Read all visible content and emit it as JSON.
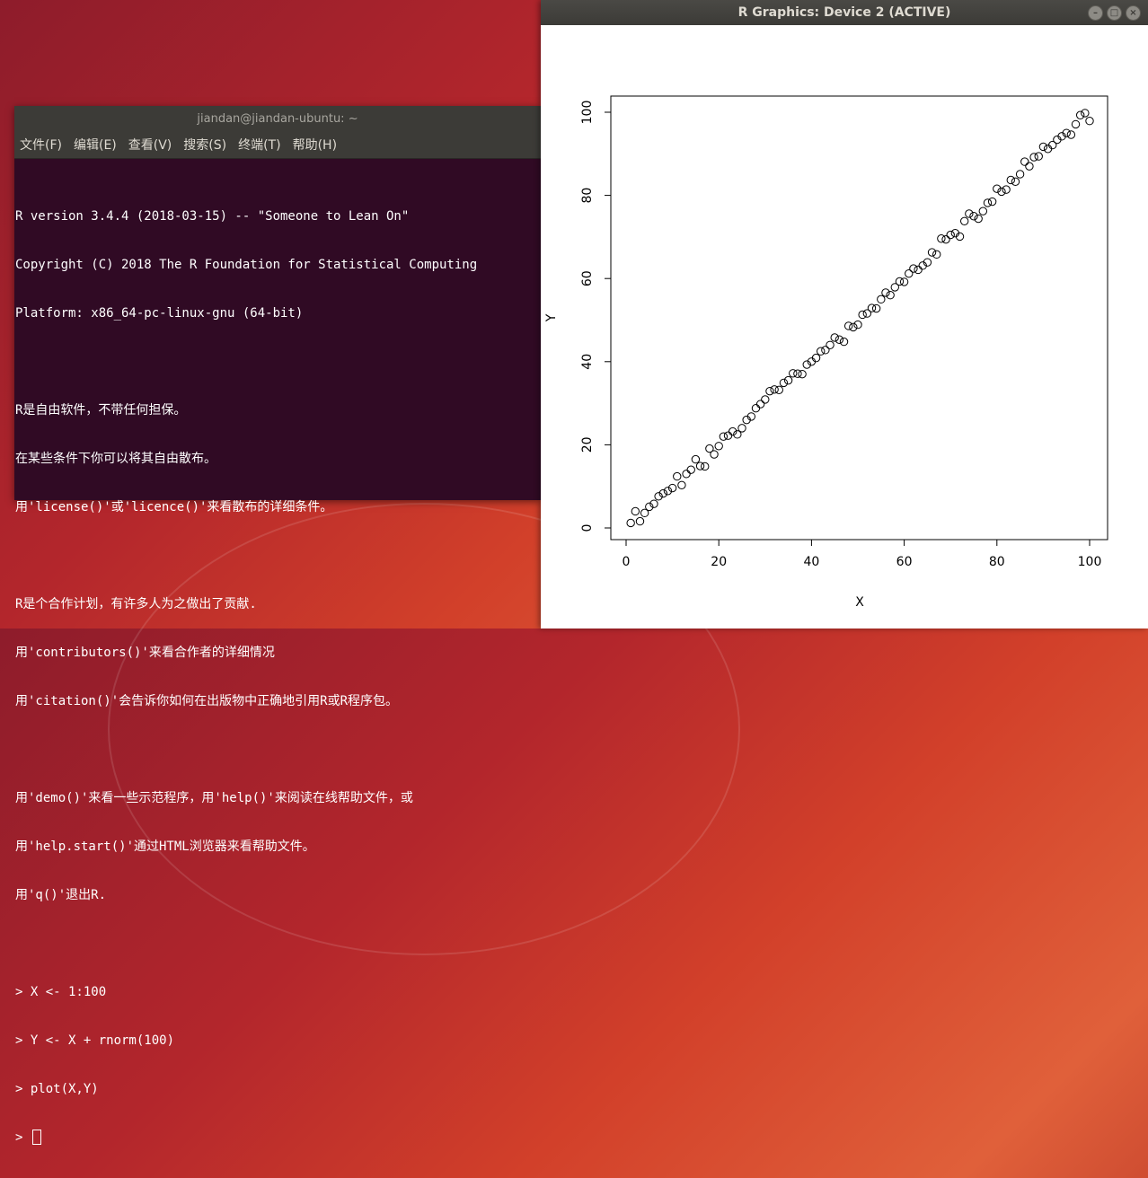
{
  "terminal": {
    "title": "jiandan@jiandan-ubuntu: ~",
    "menu": [
      "文件(F)",
      "编辑(E)",
      "查看(V)",
      "搜索(S)",
      "终端(T)",
      "帮助(H)"
    ],
    "lines": [
      "R version 3.4.4 (2018-03-15) -- \"Someone to Lean On\"",
      "Copyright (C) 2018 The R Foundation for Statistical Computing",
      "Platform: x86_64-pc-linux-gnu (64-bit)",
      "",
      "R是自由软件，不带任何担保。",
      "在某些条件下你可以将其自由散布。",
      "用'license()'或'licence()'来看散布的详细条件。",
      "",
      "R是个合作计划，有许多人为之做出了贡献.",
      "用'contributors()'来看合作者的详细情况",
      "用'citation()'会告诉你如何在出版物中正确地引用R或R程序包。",
      "",
      "用'demo()'来看一些示范程序，用'help()'来阅读在线帮助文件，或",
      "用'help.start()'通过HTML浏览器来看帮助文件。",
      "用'q()'退出R.",
      "",
      "> X <- 1:100",
      "> Y <- X + rnorm(100)",
      "> plot(X,Y)"
    ],
    "prompt": "> "
  },
  "graphics_window": {
    "title": "R Graphics: Device 2 (ACTIVE)",
    "buttons": {
      "minimize": "–",
      "maximize": "□",
      "close": "×"
    }
  },
  "chart_data": {
    "type": "scatter",
    "xlabel": "X",
    "ylabel": "Y",
    "xlim": [
      0,
      100
    ],
    "ylim": [
      0,
      100
    ],
    "xticks": [
      0,
      20,
      40,
      60,
      80,
      100
    ],
    "yticks": [
      0,
      20,
      40,
      60,
      80,
      100
    ],
    "grid": false,
    "x": [
      1,
      2,
      3,
      4,
      5,
      6,
      7,
      8,
      9,
      10,
      11,
      12,
      13,
      14,
      15,
      16,
      17,
      18,
      19,
      20,
      21,
      22,
      23,
      24,
      25,
      26,
      27,
      28,
      29,
      30,
      31,
      32,
      33,
      34,
      35,
      36,
      37,
      38,
      39,
      40,
      41,
      42,
      43,
      44,
      45,
      46,
      47,
      48,
      49,
      50,
      51,
      52,
      53,
      54,
      55,
      56,
      57,
      58,
      59,
      60,
      61,
      62,
      63,
      64,
      65,
      66,
      67,
      68,
      69,
      70,
      71,
      72,
      73,
      74,
      75,
      76,
      77,
      78,
      79,
      80,
      81,
      82,
      83,
      84,
      85,
      86,
      87,
      88,
      89,
      90,
      91,
      92,
      93,
      94,
      95,
      96,
      97,
      98,
      99,
      100
    ],
    "y": [
      1.2,
      4.0,
      1.6,
      3.6,
      5.1,
      5.8,
      7.6,
      8.3,
      8.9,
      9.6,
      12.4,
      10.3,
      13.0,
      14.0,
      16.5,
      14.9,
      14.8,
      19.1,
      17.7,
      19.7,
      22.0,
      22.2,
      23.2,
      22.5,
      24.0,
      26.0,
      26.8,
      28.8,
      29.8,
      30.9,
      32.9,
      33.3,
      33.2,
      34.9,
      35.5,
      37.2,
      37.1,
      37.0,
      39.3,
      40.0,
      40.9,
      42.5,
      42.8,
      44.0,
      45.8,
      45.3,
      44.8,
      48.6,
      48.3,
      48.9,
      51.3,
      51.6,
      52.9,
      52.8,
      55.0,
      56.6,
      56.0,
      57.9,
      59.3,
      59.2,
      61.2,
      62.4,
      62.1,
      63.1,
      63.9,
      66.3,
      65.8,
      69.6,
      69.4,
      70.5,
      70.9,
      70.1,
      73.8,
      75.6,
      75.0,
      74.4,
      76.2,
      78.2,
      78.5,
      81.6,
      80.9,
      81.4,
      83.7,
      83.3,
      85.1,
      88.1,
      87.0,
      89.2,
      89.4,
      91.7,
      91.2,
      92.1,
      93.4,
      94.2,
      95.0,
      94.6,
      97.1,
      99.3,
      99.8,
      97.9
    ]
  }
}
